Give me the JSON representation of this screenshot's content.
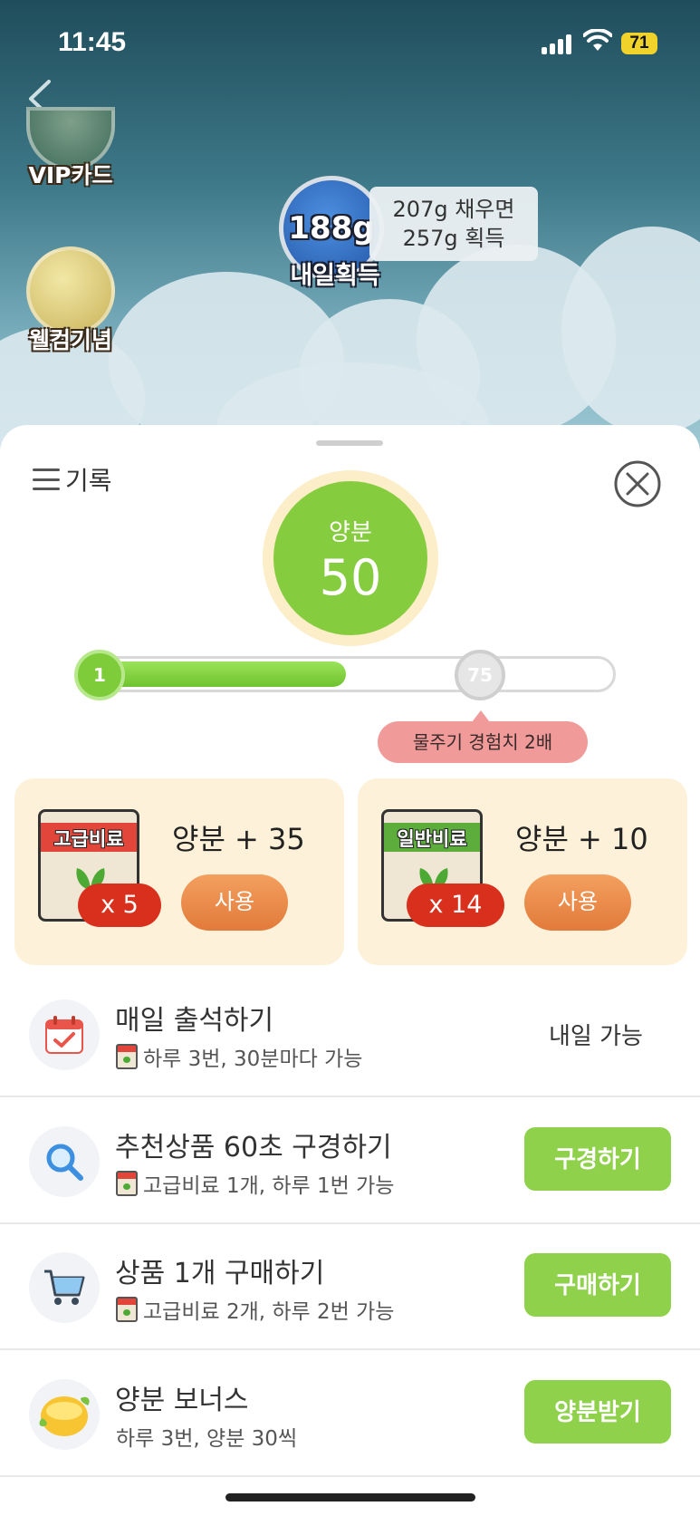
{
  "status_bar": {
    "time": "11:45",
    "battery": "71",
    "battery_color": "#f0d32a"
  },
  "background": {
    "side_badges": [
      {
        "label": "VIP카드",
        "icon": "shield-icon"
      },
      {
        "label": "웰컴기념",
        "icon": "puppy-icon"
      }
    ],
    "harvest": {
      "amount": "188g",
      "label": "내일획득",
      "tip_line1": "207g 채우면",
      "tip_line2": "257g 획득"
    }
  },
  "sheet": {
    "history_label": "기록",
    "nutrient": {
      "label": "양분",
      "value": "50"
    },
    "progress": {
      "start_level": "1",
      "end_level": "75",
      "fill_fraction": 0.5
    },
    "exp_tip": "물주기 경험치 2배",
    "fertilizers": [
      {
        "name": "고급비료",
        "count": "x 5",
        "gain": "양분 + 35",
        "button": "사용",
        "band_color": "#e2463b"
      },
      {
        "name": "일반비료",
        "count": "x 14",
        "gain": "양분 + 10",
        "button": "사용",
        "band_color": "#5cad3c"
      }
    ],
    "missions": [
      {
        "title": "매일 출석하기",
        "desc": "하루 3번, 30분마다 가능",
        "status": "내일 가능",
        "icon": "calendar-icon",
        "has_bag": true
      },
      {
        "title": "추천상품 60초 구경하기",
        "desc": "고급비료 1개, 하루 1번 가능",
        "button": "구경하기",
        "icon": "search-icon",
        "has_bag": true
      },
      {
        "title": "상품 1개 구매하기",
        "desc": "고급비료 2개, 하루 2번 가능",
        "button": "구매하기",
        "icon": "cart-icon",
        "has_bag": true
      },
      {
        "title": "양분 보너스",
        "desc": "하루 3번, 양분 30씩",
        "button": "양분받기",
        "icon": "nutrient-bowl-icon",
        "has_bag": false
      }
    ],
    "accent_green": "#8fd14b",
    "accent_orange": "#e27a3a"
  }
}
